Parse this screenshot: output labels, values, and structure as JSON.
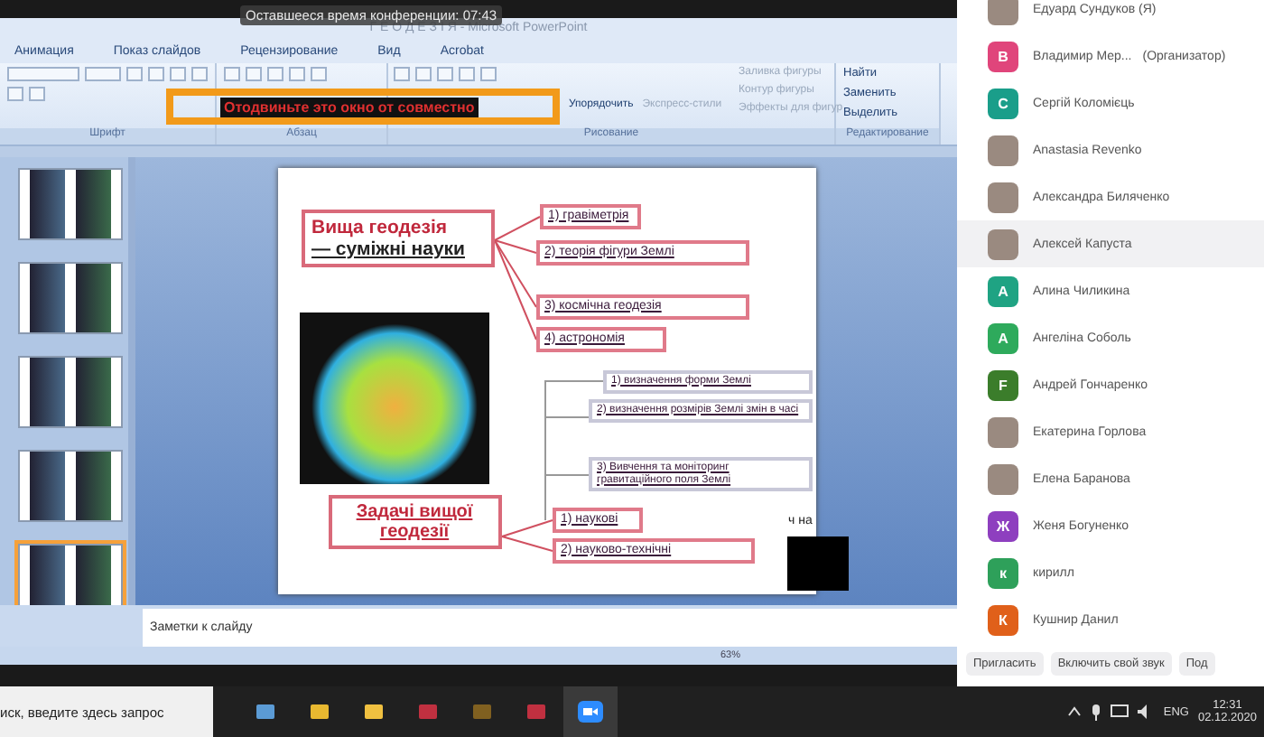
{
  "banner": "Оставшееся время конференции: 07:43",
  "window": {
    "title": "Г Е О Д Е З І Я - Microsoft PowerPoint"
  },
  "ribbon_tabs": [
    "Анимация",
    "Показ слайдов",
    "Рецензирование",
    "Вид",
    "Acrobat"
  ],
  "ribbon": {
    "groups": [
      "Шрифт",
      "Абзац",
      "Рисование",
      "Редактирование"
    ],
    "drawing_buttons": [
      "Упорядочить",
      "Экспресс-стили"
    ],
    "shape_buttons": [
      "Заливка фигуры",
      "Контур фигуры",
      "Эффекты для фигур"
    ],
    "editing_buttons": [
      "Найти",
      "Заменить",
      "Выделить"
    ]
  },
  "share_warning": "Отодвиньте это окно от совместно",
  "thumbnails": [
    {
      "selected": false
    },
    {
      "selected": false
    },
    {
      "selected": false
    },
    {
      "selected": false
    },
    {
      "selected": true
    }
  ],
  "slide": {
    "title_line1": "Вища геодезія",
    "title_line2": "— суміжні науки",
    "sciences": [
      "1) гравіметрія",
      "2) теорія фігури Землі",
      "3) космічна геодезія",
      "4) астрономія"
    ],
    "goals": [
      "1) визначення форми Землі",
      "2) визначення розмірів Землі змін в часі",
      "3) Вивчення та моніторинг гравитаційного поля Землі"
    ],
    "tasks_title": "Задачі вищої геодезії",
    "tasks": [
      "1) наукові",
      "2) науково-технічні"
    ],
    "cut_text": "ч на"
  },
  "notes_placeholder": "Заметки к слайду",
  "status_bar": {
    "zoom": "63%"
  },
  "participants": [
    {
      "name": "Едуард Сундуков (Я)",
      "kind": "photo",
      "selected": false
    },
    {
      "name": "Владимир Мер...",
      "role": "(Организатор)",
      "kind": "letter",
      "letter": "В",
      "color": "#e0457b",
      "selected": false
    },
    {
      "name": "Сергій Коломієць",
      "kind": "letter",
      "letter": "С",
      "color": "#1a9e8a",
      "selected": false
    },
    {
      "name": "Anastasia Revenko",
      "kind": "photo",
      "selected": false
    },
    {
      "name": "Александра Биляченко",
      "kind": "photo",
      "selected": false
    },
    {
      "name": "Алексей Капуста",
      "kind": "photo",
      "selected": true
    },
    {
      "name": "Алина Чиликина",
      "kind": "letter",
      "letter": "А",
      "color": "#1fa383",
      "selected": false
    },
    {
      "name": "Ангеліна Соболь",
      "kind": "letter",
      "letter": "А",
      "color": "#2eaa5c",
      "selected": false
    },
    {
      "name": "Андрей Гончаренко",
      "kind": "letter",
      "letter": "F",
      "color": "#3b7d2b",
      "selected": false
    },
    {
      "name": "Екатерина Горлова",
      "kind": "photo",
      "selected": false
    },
    {
      "name": "Елена Баранова",
      "kind": "photo",
      "selected": false
    },
    {
      "name": "Женя Богуненко",
      "kind": "letter",
      "letter": "Ж",
      "color": "#8e3fbf",
      "selected": false
    },
    {
      "name": "кирилл",
      "kind": "letter",
      "letter": "к",
      "color": "#2ea05a",
      "selected": false
    },
    {
      "name": "Кушнир Данил",
      "kind": "letter",
      "letter": "К",
      "color": "#e0601a",
      "selected": false
    }
  ],
  "panel_buttons": [
    "Пригласить",
    "Включить свой звук",
    "Под"
  ],
  "taskbar": {
    "search": "иск, введите здесь запрос",
    "language": "ENG",
    "time": "12:31",
    "date": "02.12.2020"
  }
}
